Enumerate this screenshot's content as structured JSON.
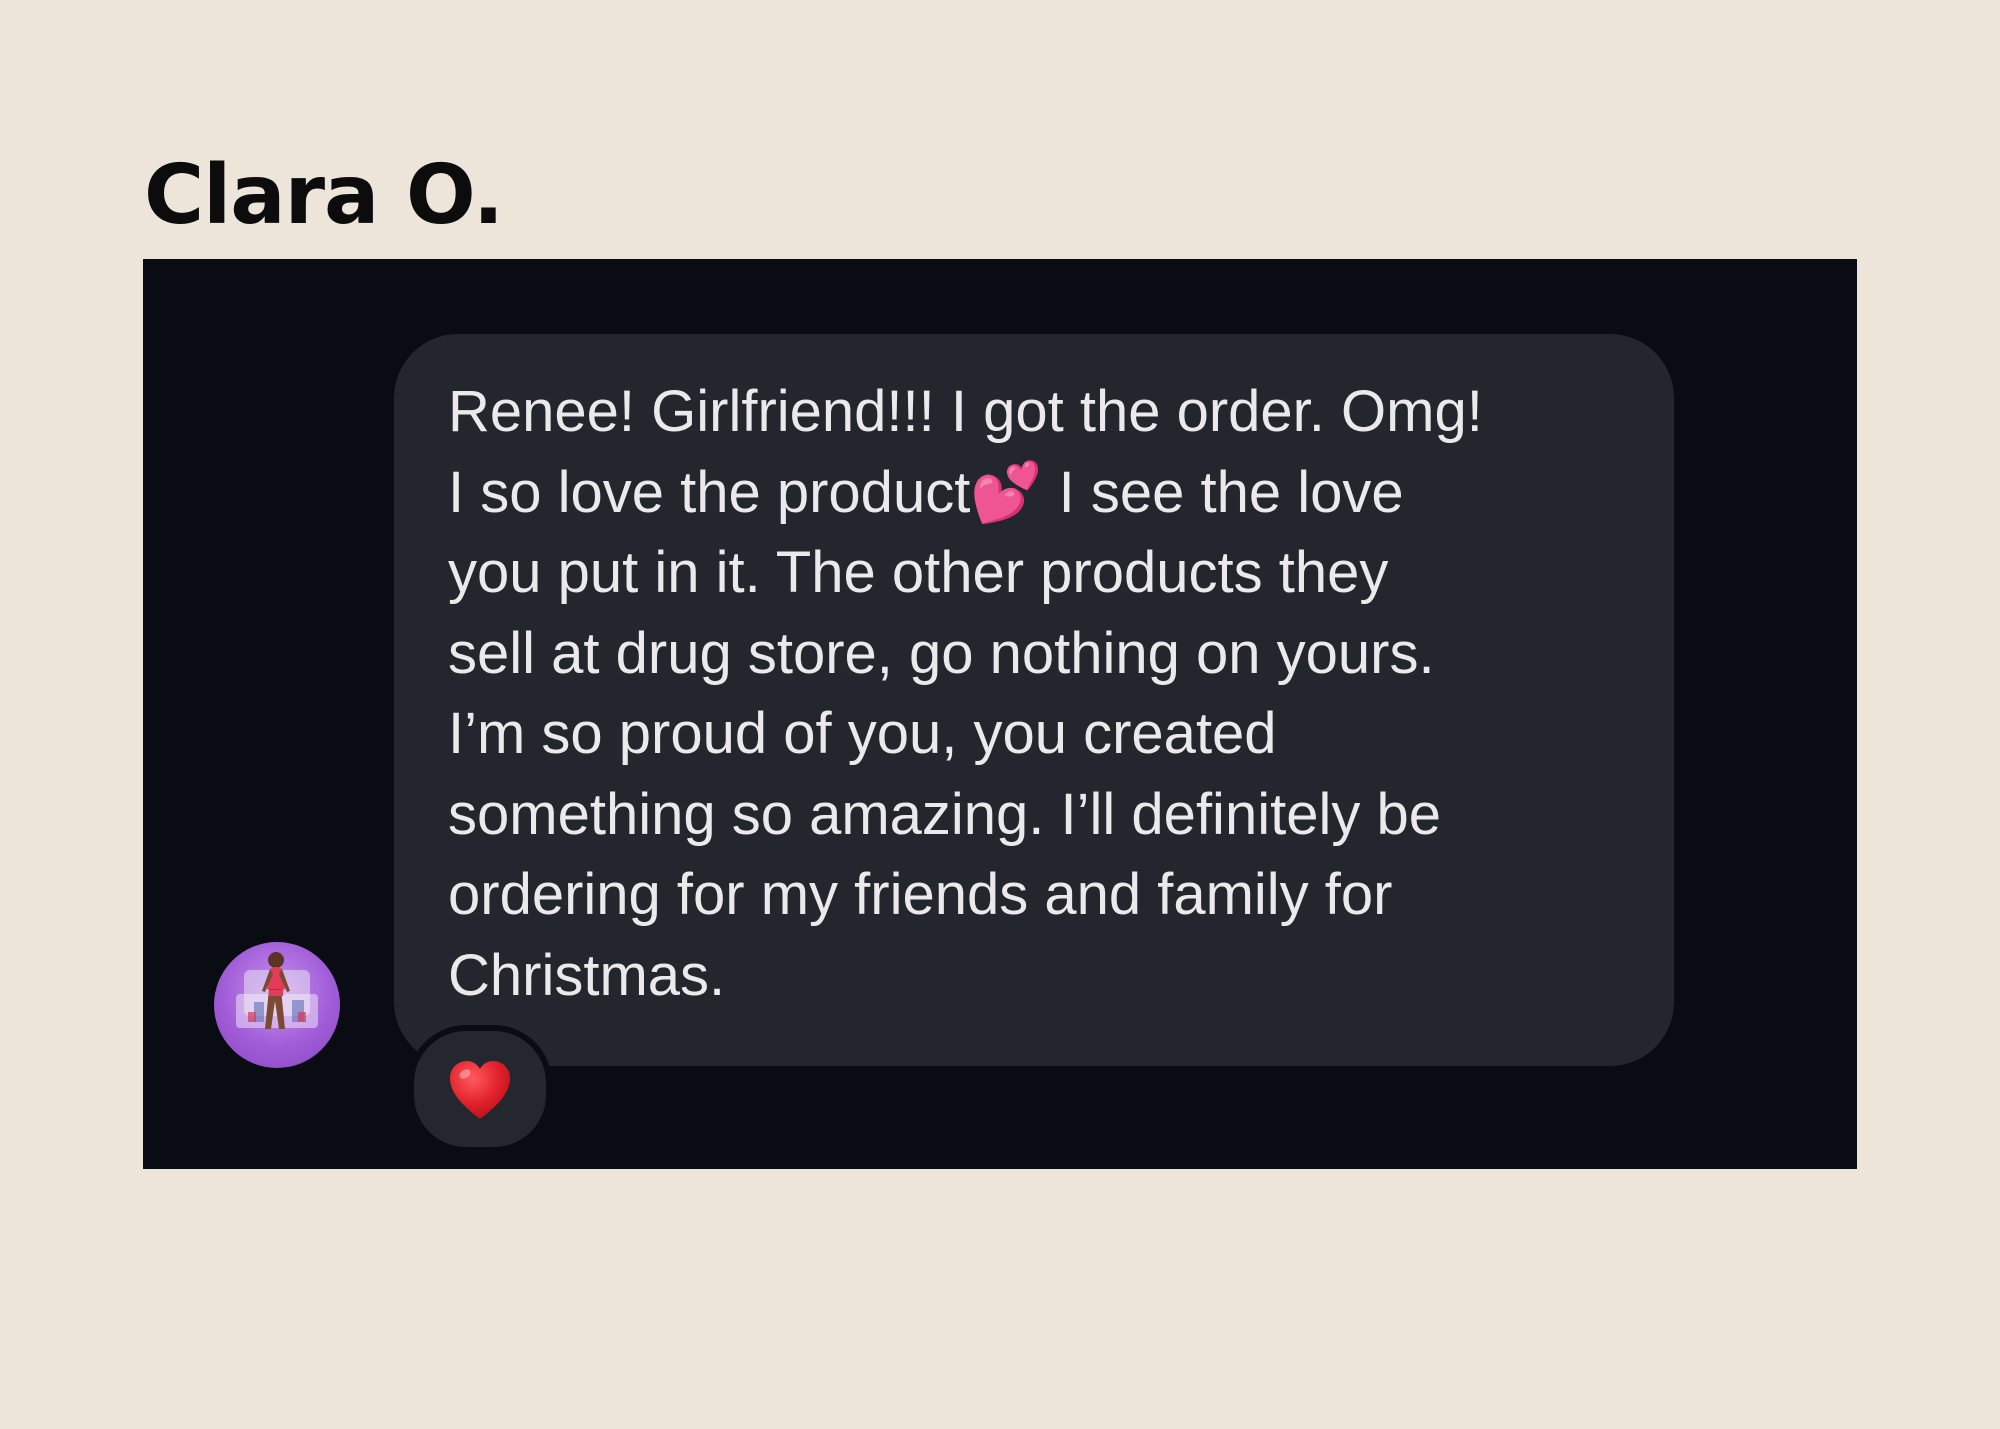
{
  "reviewer": {
    "name": "Clara O."
  },
  "message": {
    "text": "Renee! Girlfriend!!! I got the order. Omg!\nI so love the product💕 I see the love\nyou put in it. The other products they\nsell at drug store, go nothing on yours.\nI’m so proud of you, you created\nsomething so amazing. I’ll definitely be\nordering for my friends and family for\nChristmas."
  },
  "reaction": {
    "emoji": "❤️",
    "icon": "red-heart-icon"
  },
  "avatar": {
    "icon": "profile-photo-avatar"
  },
  "colors": {
    "page_background": "#ede4da",
    "panel_background": "#0a0c14",
    "bubble_background": "#24262d",
    "message_text": "#eaeaea",
    "heart": "#e0202a"
  }
}
